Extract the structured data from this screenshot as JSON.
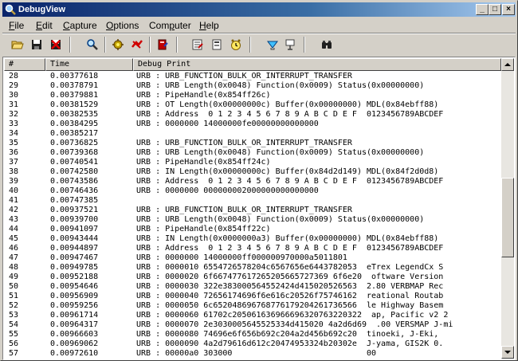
{
  "window": {
    "title": "DebugView",
    "min_glyph": "_",
    "max_glyph": "□",
    "close_glyph": "×"
  },
  "menu": [
    {
      "accel": "F",
      "rest": "ile"
    },
    {
      "accel": "E",
      "rest": "dit"
    },
    {
      "accel": "C",
      "rest": "apture"
    },
    {
      "accel": "O",
      "rest": "ptions"
    },
    {
      "pre": "Com",
      "accel": "p",
      "rest": "uter"
    },
    {
      "accel": "H",
      "rest": "elp"
    }
  ],
  "toolbar_icons": [
    "open-icon",
    "save-icon",
    "clear-icon",
    "find-icon",
    "capture-icon",
    "capture-kernel-icon",
    "log-icon",
    "filter-icon",
    "highlight-icon",
    "clock-icon",
    "connect-icon",
    "disconnect-icon",
    "binoculars-icon"
  ],
  "columns": {
    "num": "#",
    "time": "Time",
    "msg": "Debug Print"
  },
  "rows": [
    {
      "n": "28",
      "t": "0.00377618",
      "m": "URB : URB_FUNCTION_BULK_OR_INTERRUPT_TRANSFER"
    },
    {
      "n": "29",
      "t": "0.00378791",
      "m": "URB : URB Length(0x0048) Function(0x0009) Status(0x00000000)"
    },
    {
      "n": "30",
      "t": "0.00379881",
      "m": "URB : PipeHandle(0x854ff26c)"
    },
    {
      "n": "31",
      "t": "0.00381529",
      "m": "URB : OT Length(0x00000000c) Buffer(0x00000000) MDL(0x84ebff88)"
    },
    {
      "n": "32",
      "t": "0.00382535",
      "m": "URB : Address  0 1 2 3 4 5 6 7 8 9 A B C D E F  0123456789ABCDEF"
    },
    {
      "n": "33",
      "t": "0.00384295",
      "m": "URB : 0000000 14000000fe00000000000000"
    },
    {
      "n": "34",
      "t": "0.00385217",
      "m": ""
    },
    {
      "n": "35",
      "t": "0.00736825",
      "m": "URB : URB_FUNCTION_BULK_OR_INTERRUPT_TRANSFER"
    },
    {
      "n": "36",
      "t": "0.00739368",
      "m": "URB : URB Length(0x0048) Function(0x0009) Status(0x00000000)"
    },
    {
      "n": "37",
      "t": "0.00740541",
      "m": "URB : PipeHandle(0x854ff24c)"
    },
    {
      "n": "38",
      "t": "0.00742580",
      "m": "URB : IN Length(0x00000000c) Buffer(0x84d2d149) MDL(0x84f2d0d8)"
    },
    {
      "n": "39",
      "t": "0.00743586",
      "m": "URB : Address  0 1 2 3 4 5 6 7 8 9 A B C D E F  0123456789ABCDEF"
    },
    {
      "n": "40",
      "t": "0.00746436",
      "m": "URB : 0000000 000000002000000000000000"
    },
    {
      "n": "41",
      "t": "0.00747385",
      "m": ""
    },
    {
      "n": "42",
      "t": "0.00937521",
      "m": "URB : URB_FUNCTION_BULK_OR_INTERRUPT_TRANSFER"
    },
    {
      "n": "43",
      "t": "0.00939700",
      "m": "URB : URB Length(0x0048) Function(0x0009) Status(0x00000000)"
    },
    {
      "n": "44",
      "t": "0.00941097",
      "m": "URB : PipeHandle(0x854ff22c)"
    },
    {
      "n": "45",
      "t": "0.00943444",
      "m": "URB : IN Length(0x0000000a3) Buffer(0x00000000) MDL(0x84ebff88)"
    },
    {
      "n": "46",
      "t": "0.00944897",
      "m": "URB : Address  0 1 2 3 4 5 6 7 8 9 A B C D E F  0123456789ABCDEF"
    },
    {
      "n": "47",
      "t": "0.00947467",
      "m": "URB : 0000000 14000000ff000000970000a5011801"
    },
    {
      "n": "48",
      "t": "0.00949785",
      "m": "URB : 0000010 6554726578204c6567656e6443782053  eTrex LegendCx S"
    },
    {
      "n": "49",
      "t": "0.00952188",
      "m": "URB : 0000020 6f667477617265205665727369 6f6e20  oftware Version"
    },
    {
      "n": "50",
      "t": "0.00954646",
      "m": "URB : 0000030 322e383000564552424d415020526563  2.80 VERBMAP Rec"
    },
    {
      "n": "51",
      "t": "0.00956909",
      "m": "URB : 0000040 72656174696f6e616c20526f75746162  reational Routab"
    },
    {
      "n": "52",
      "t": "0.00959256",
      "m": "URB : 0000050 6c652048696768776179204261736566  le Highway Basem"
    },
    {
      "n": "53",
      "t": "0.00961714",
      "m": "URB : 0000060 61702c205061636966696320763220322  ap, Pacific v2 2"
    },
    {
      "n": "54",
      "t": "0.00964317",
      "m": "URB : 0000070 2e3030005645525334d415020 4a2d6d69  .00 VERSMAP J-mi"
    },
    {
      "n": "55",
      "t": "0.00966603",
      "m": "URB : 0000080 74696e6f656b692c204a2d456b692c20  tinoeki, J-Eki,"
    },
    {
      "n": "56",
      "t": "0.00969062",
      "m": "URB : 0000090 4a2d79616d612c20474953324b20302e  J-yama, GIS2K 0."
    },
    {
      "n": "57",
      "t": "0.00972610",
      "m": "URB : 00000a0 303000                            00"
    }
  ]
}
